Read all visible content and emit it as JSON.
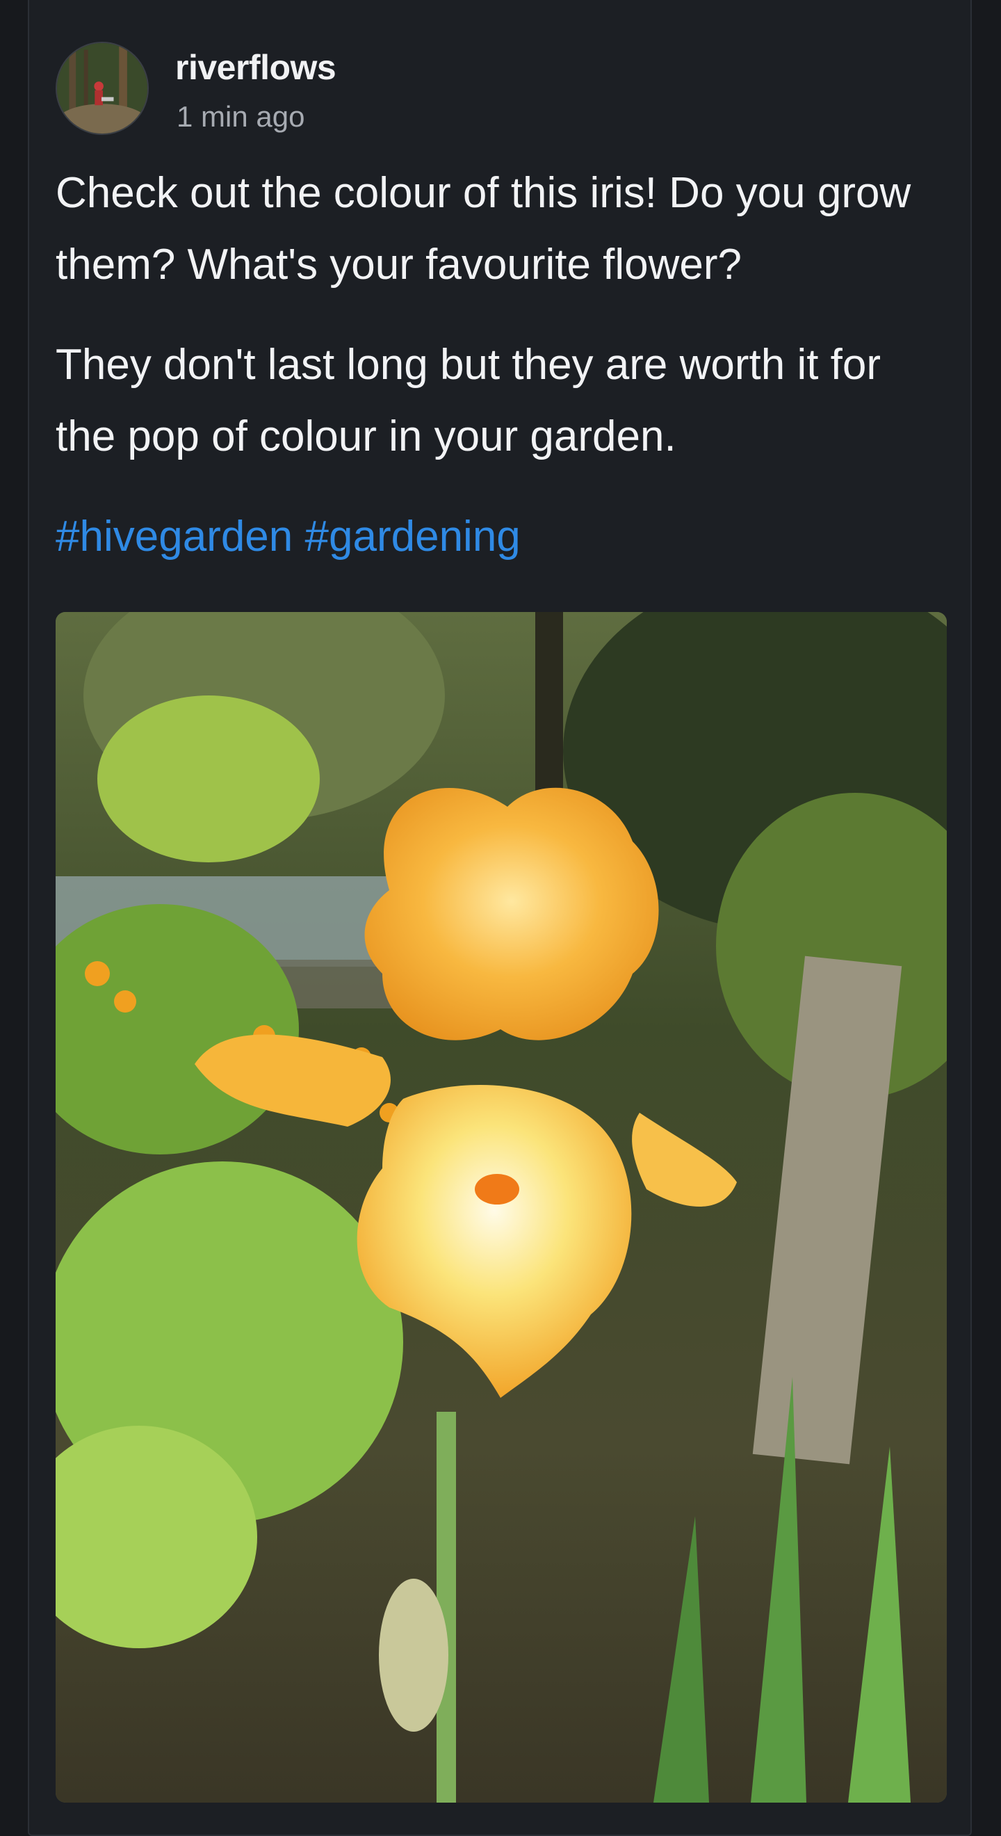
{
  "post": {
    "author": {
      "username": "riverflows",
      "avatar_icon": "avatar-forest-photo"
    },
    "timestamp": "1 min ago",
    "paragraphs": [
      "Check out the colour of this iris! Do you grow them? What's your favourite flower?",
      "They don't last long but they are worth it for the pop of colour in your garden."
    ],
    "hashtags": [
      "#hivegarden",
      "#gardening"
    ],
    "image": {
      "subject": "yellow bearded iris in a garden"
    }
  },
  "colors": {
    "background": "#17191d",
    "card": "#1c1f24",
    "text": "#f2f3f5",
    "muted": "#a7abb2",
    "link": "#2f8ae5"
  }
}
